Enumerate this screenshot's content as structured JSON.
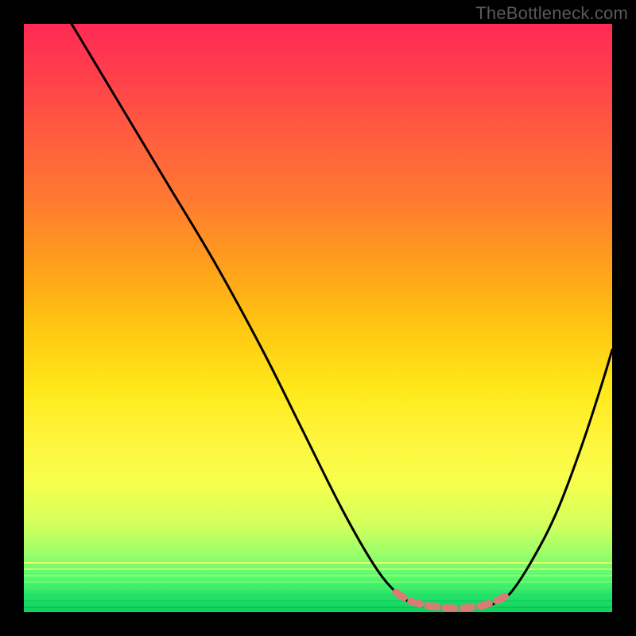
{
  "watermark": "TheBottleneck.com",
  "colors": {
    "curve": "#000000",
    "dash": "#d97c77",
    "gradient_top": "#ff2a55",
    "gradient_bottom": "#0fd060"
  },
  "chart_data": {
    "type": "line",
    "title": "",
    "xlabel": "",
    "ylabel": "",
    "xlim": [
      30,
      770
    ],
    "ylim": [
      30,
      770
    ],
    "notes": "V-shaped bottleneck curve over a red→green vertical heat gradient. Trough ≈ x 500–640 at y≈765 (near bottom). Left branch starts at top-left of plot area; right branch rises to roughly mid-height at right edge.",
    "series": [
      {
        "name": "left_branch",
        "points": [
          [
            90,
            30
          ],
          [
            150,
            130
          ],
          [
            210,
            230
          ],
          [
            270,
            330
          ],
          [
            330,
            440
          ],
          [
            380,
            540
          ],
          [
            430,
            640
          ],
          [
            470,
            710
          ],
          [
            498,
            745
          ],
          [
            520,
            760
          ]
        ]
      },
      {
        "name": "right_branch",
        "points": [
          [
            620,
            760
          ],
          [
            642,
            746
          ],
          [
            672,
            700
          ],
          [
            702,
            640
          ],
          [
            732,
            560
          ],
          [
            758,
            480
          ],
          [
            770,
            440
          ]
        ]
      },
      {
        "name": "trough_dash",
        "points": [
          [
            498,
            745
          ],
          [
            516,
            756
          ],
          [
            540,
            762
          ],
          [
            570,
            765
          ],
          [
            600,
            763
          ],
          [
            624,
            756
          ],
          [
            642,
            746
          ]
        ]
      }
    ]
  }
}
